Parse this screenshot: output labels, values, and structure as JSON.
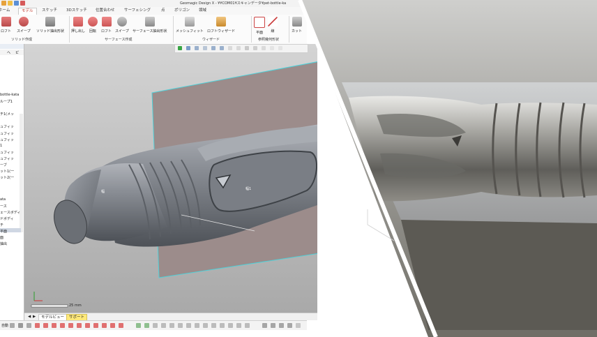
{
  "window": {
    "title": "Geomagic Design X - ¥¥COM01¥スキャンデータ¥pet-bottle-ka"
  },
  "ribbon_tabs": [
    "ホーム",
    "モデル",
    "スケッチ",
    "3Dスケッチ",
    "位置合わせ",
    "サーフェシング",
    "点",
    "ポリゴン",
    "領域"
  ],
  "active_tab": "モデル",
  "ribbon": {
    "buttons": [
      "ロフト",
      "スイープ",
      "ソリッド抽出形状",
      "押し出し",
      "回転",
      "ロフト",
      "スイープ",
      "サーフェース抽出形状",
      "メッシュフィット",
      "ロフトウィザード",
      "平面",
      "線",
      "カット"
    ],
    "groups": [
      "ソリッド作成",
      "サーフェース作成",
      "ウィザード",
      "参照幾何形状"
    ]
  },
  "left_panel": {
    "items": [
      "へ",
      "ピ",
      "bottle-kata",
      "ループ1",
      "チ1(メッ",
      "ュフィッ",
      "ュフィッ",
      "ュフィッ",
      "1",
      "ュフィッ",
      "ュフィッ",
      "ーブ",
      "ット1(一",
      "ット2(一",
      "ata",
      "ース",
      "ェースボディ",
      "ドボディ",
      "チ",
      "平面",
      "面",
      "抽出"
    ]
  },
  "viewport": {
    "feature_labels": [
      "幅",
      "幅1"
    ],
    "scale_label": "25 mm"
  },
  "bottom_tabs": [
    "モデルビュー",
    "サポート"
  ],
  "status": {
    "left_label": "自動"
  },
  "colors": {
    "accent": "#c0392b",
    "plane": "#9c8c8b",
    "plane_edge": "#4fd1d9",
    "support_tab": "#ffe97a"
  }
}
